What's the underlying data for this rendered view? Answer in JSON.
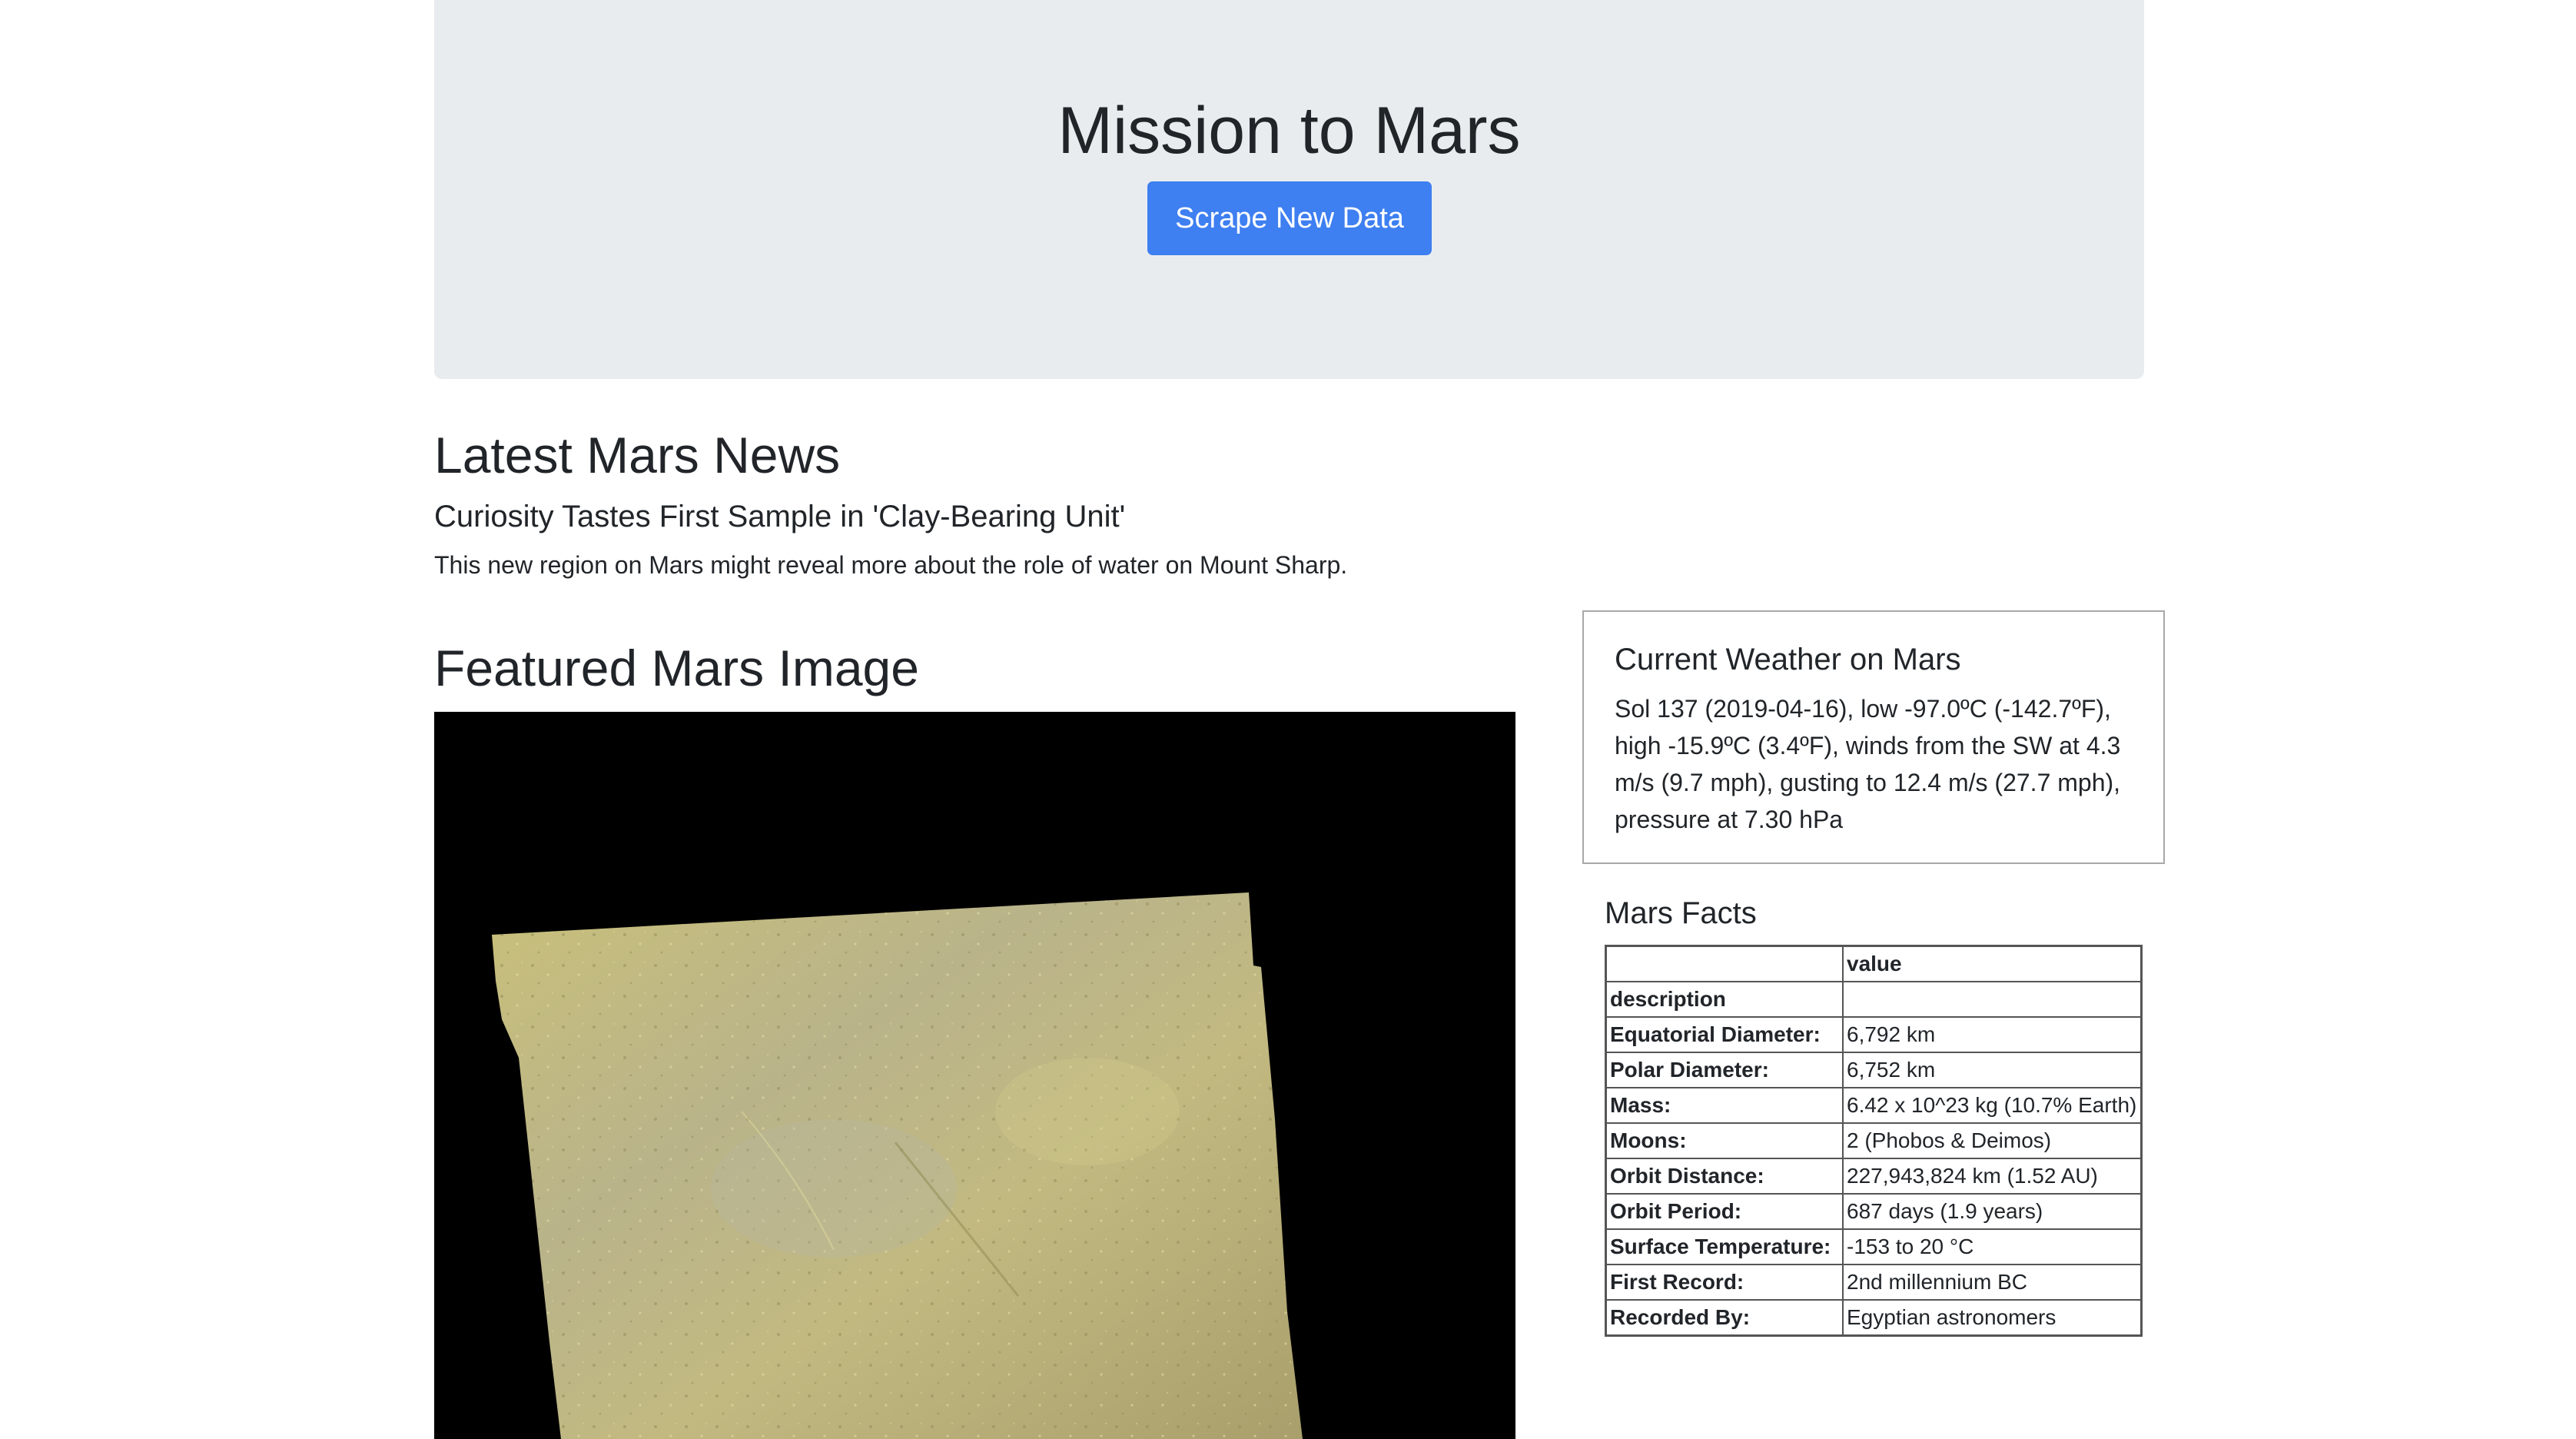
{
  "header": {
    "title": "Mission to Mars",
    "scrape_button": "Scrape New Data"
  },
  "news": {
    "heading": "Latest Mars News",
    "title": "Curiosity Tastes First Sample in 'Clay-Bearing Unit'",
    "teaser": "This new region on Mars might reveal more about the role of water on Mount Sharp."
  },
  "featured": {
    "heading": "Featured Mars Image"
  },
  "weather": {
    "title": "Current Weather on Mars",
    "text": "Sol 137 (2019-04-16), low -97.0ºC (-142.7ºF), high -15.9ºC (3.4ºF), winds from the SW at 4.3 m/s (9.7 mph), gusting to 12.4 m/s (27.7 mph), pressure at 7.30 hPa"
  },
  "facts": {
    "title": "Mars Facts",
    "header_value": "value",
    "header_desc": "description",
    "rows": [
      {
        "label": "Equatorial Diameter:",
        "value": "6,792 km"
      },
      {
        "label": "Polar Diameter:",
        "value": "6,752 km"
      },
      {
        "label": "Mass:",
        "value": "6.42 x 10^23 kg (10.7% Earth)"
      },
      {
        "label": "Moons:",
        "value": "2 (Phobos & Deimos)"
      },
      {
        "label": "Orbit Distance:",
        "value": "227,943,824 km (1.52 AU)"
      },
      {
        "label": "Orbit Period:",
        "value": "687 days (1.9 years)"
      },
      {
        "label": "Surface Temperature:",
        "value": "-153 to 20 °C"
      },
      {
        "label": "First Record:",
        "value": "2nd millennium BC"
      },
      {
        "label": "Recorded By:",
        "value": "Egyptian astronomers"
      }
    ]
  },
  "colors": {
    "jumbotron_bg": "#e9ecef",
    "button_bg": "#3e7ff1",
    "text": "#212529"
  }
}
